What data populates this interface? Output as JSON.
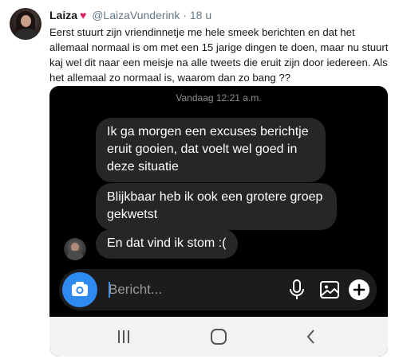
{
  "tweet": {
    "name": "Laiza",
    "heart": "♥",
    "handle": "@LaizaVunderink",
    "separator": "·",
    "time": "18 u",
    "text": "Eerst stuurt zijn vriendinnetje me hele smeek berichten en dat het allemaal normaal is om met een 15 jarige dingen te doen, maar nu stuurt kaj wel dit naar een meisje na alle tweets die eruit zijn door iedereen. Als het allemaal zo normaal is, waarom dan zo bang ??"
  },
  "chat": {
    "date_label": "Vandaag 12:21 a.m.",
    "messages": [
      "Ik ga morgen een excuses berichtje eruit gooien, dat voelt wel goed in deze situatie",
      "Blijkbaar heb ik ook een grotere groep gekwetst",
      "En dat vind ik stom :("
    ],
    "composer": {
      "placeholder": "Bericht...",
      "icons": [
        "camera-icon",
        "microphone-icon",
        "gallery-icon",
        "plus-icon"
      ]
    }
  },
  "navbar": {
    "icons": [
      "recent-apps-icon",
      "home-icon",
      "back-icon"
    ]
  },
  "colors": {
    "heart": "#e0245e",
    "bubble": "#262626",
    "accent": "#2e8bef",
    "chat_background": "#000000",
    "nav_background": "#f2f2f2"
  }
}
